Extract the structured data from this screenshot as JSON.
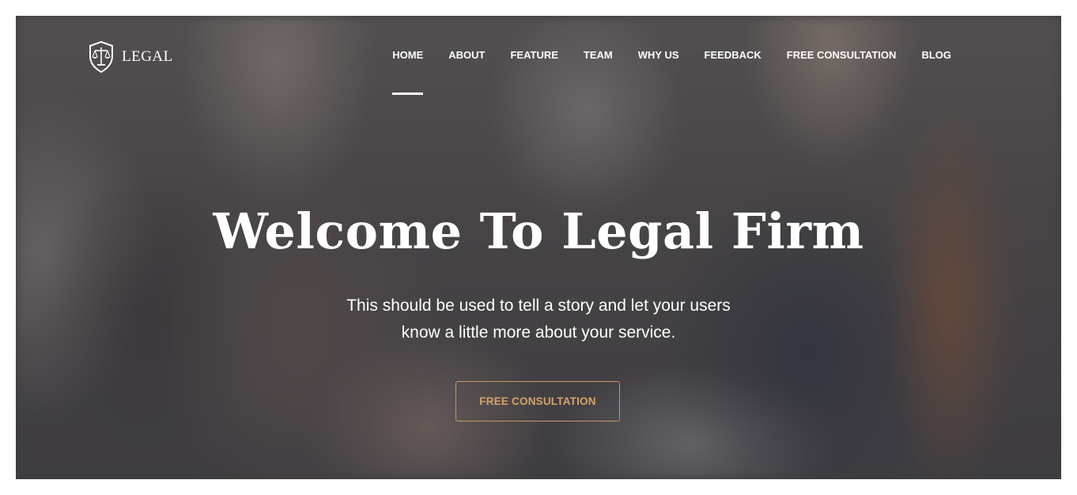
{
  "brand": {
    "name": "LEGAL",
    "icon": "scales-shield-icon"
  },
  "nav": {
    "items": [
      {
        "label": "HOME",
        "active": true
      },
      {
        "label": "ABOUT",
        "active": false
      },
      {
        "label": "FEATURE",
        "active": false
      },
      {
        "label": "TEAM",
        "active": false
      },
      {
        "label": "WHY US",
        "active": false
      },
      {
        "label": "FEEDBACK",
        "active": false
      },
      {
        "label": "FREE CONSULTATION",
        "active": false
      },
      {
        "label": "BLOG",
        "active": false
      }
    ]
  },
  "hero": {
    "title": "Welcome To Legal Firm",
    "subtitle_line1": "This should be used to tell a story and let your users",
    "subtitle_line2": "know a little more about your service.",
    "cta_label": "FREE CONSULTATION"
  },
  "colors": {
    "accent": "#c79a5c",
    "text": "#ffffff"
  }
}
